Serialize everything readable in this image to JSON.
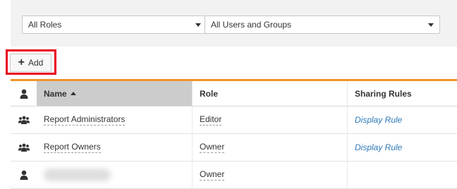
{
  "filters": {
    "roles": "All Roles",
    "users": "All Users and Groups"
  },
  "toolbar": {
    "add_label": "Add"
  },
  "table": {
    "columns": {
      "name": "Name",
      "role": "Role",
      "sharing_rules": "Sharing Rules"
    },
    "sort": "name-ascending",
    "rows": [
      {
        "icon": "group-icon",
        "name": "Report Administrators",
        "role": "Editor",
        "sharing_rule": "Display Rule"
      },
      {
        "icon": "group-icon",
        "name": "Report Owners",
        "role": "Owner",
        "sharing_rule": "Display Rule"
      },
      {
        "icon": "user-icon",
        "name": "",
        "role": "Owner",
        "sharing_rule": ""
      }
    ]
  },
  "colors": {
    "accent": "#f0942c",
    "highlight": "#e8001c",
    "link": "#2f7ab8",
    "sorted_header": "#cccccc"
  }
}
